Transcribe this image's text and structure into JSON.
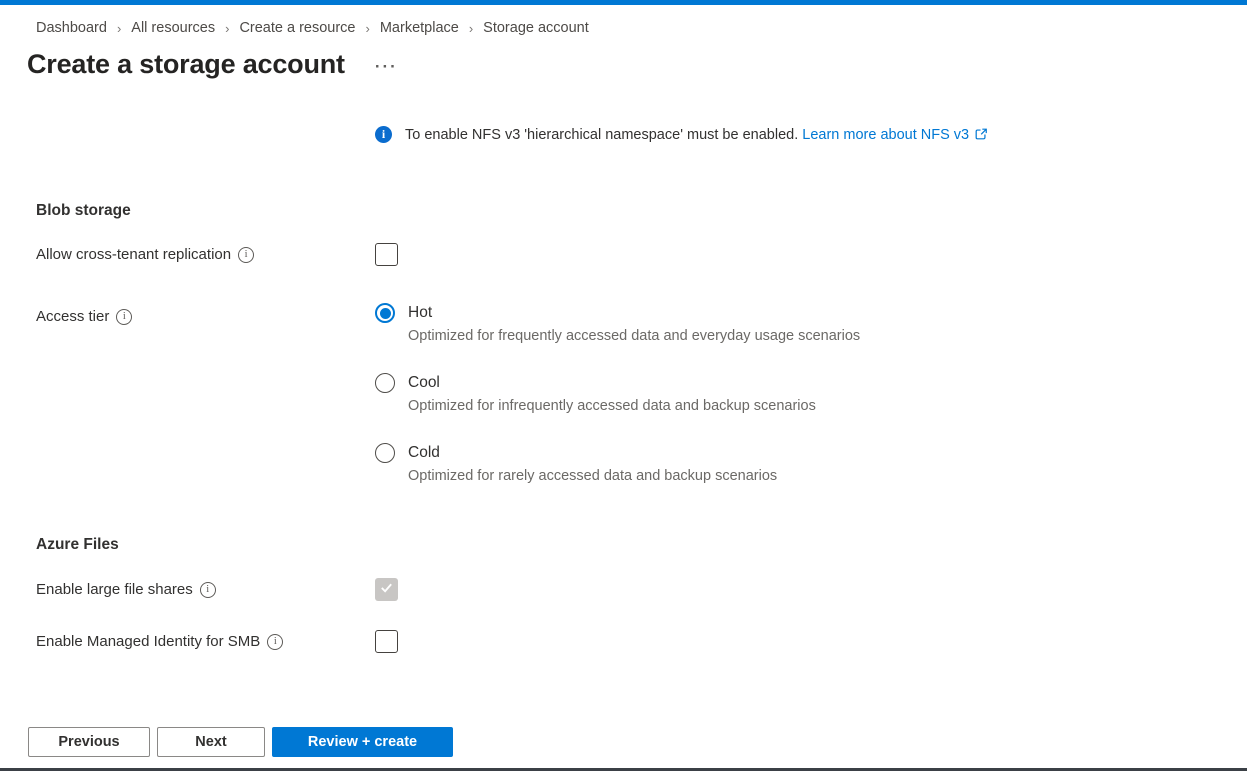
{
  "page": {
    "breadcrumb": [
      "Dashboard",
      "All resources",
      "Create a resource",
      "Marketplace",
      "Storage account"
    ],
    "breadcrumb_separator": "›",
    "title": "Create a storage account",
    "ellipsis": "···"
  },
  "banner": {
    "text": "To enable NFS v3 'hierarchical namespace' must be enabled.",
    "link_text": "Learn more about NFS v3"
  },
  "blob_section": {
    "heading": "Blob storage",
    "cross_tenant_label": "Allow cross-tenant replication",
    "access_tier_label": "Access tier",
    "tiers": [
      {
        "label": "Hot",
        "description": "Optimized for frequently accessed data and everyday usage scenarios",
        "selected": true
      },
      {
        "label": "Cool",
        "description": "Optimized for infrequently accessed data and backup scenarios",
        "selected": false
      },
      {
        "label": "Cold",
        "description": "Optimized for rarely accessed data and backup scenarios",
        "selected": false
      }
    ]
  },
  "files_section": {
    "heading": "Azure Files",
    "large_file_shares_label": "Enable large file shares",
    "large_file_shares_checked": true,
    "large_file_shares_disabled": true,
    "managed_identity_label": "Enable Managed Identity for SMB",
    "managed_identity_checked": false
  },
  "footer": {
    "previous_label": "Previous",
    "next_label": "Next",
    "review_create_label": "Review + create"
  },
  "colors": {
    "accent": "#0078d4",
    "link": "#0078d4",
    "top_bar": "#0078d4",
    "text_primary": "#323130",
    "text_secondary": "#6b6966",
    "disabled_checkbox_bg": "#c8c6c4",
    "bottom_bar": "#3b4046"
  }
}
